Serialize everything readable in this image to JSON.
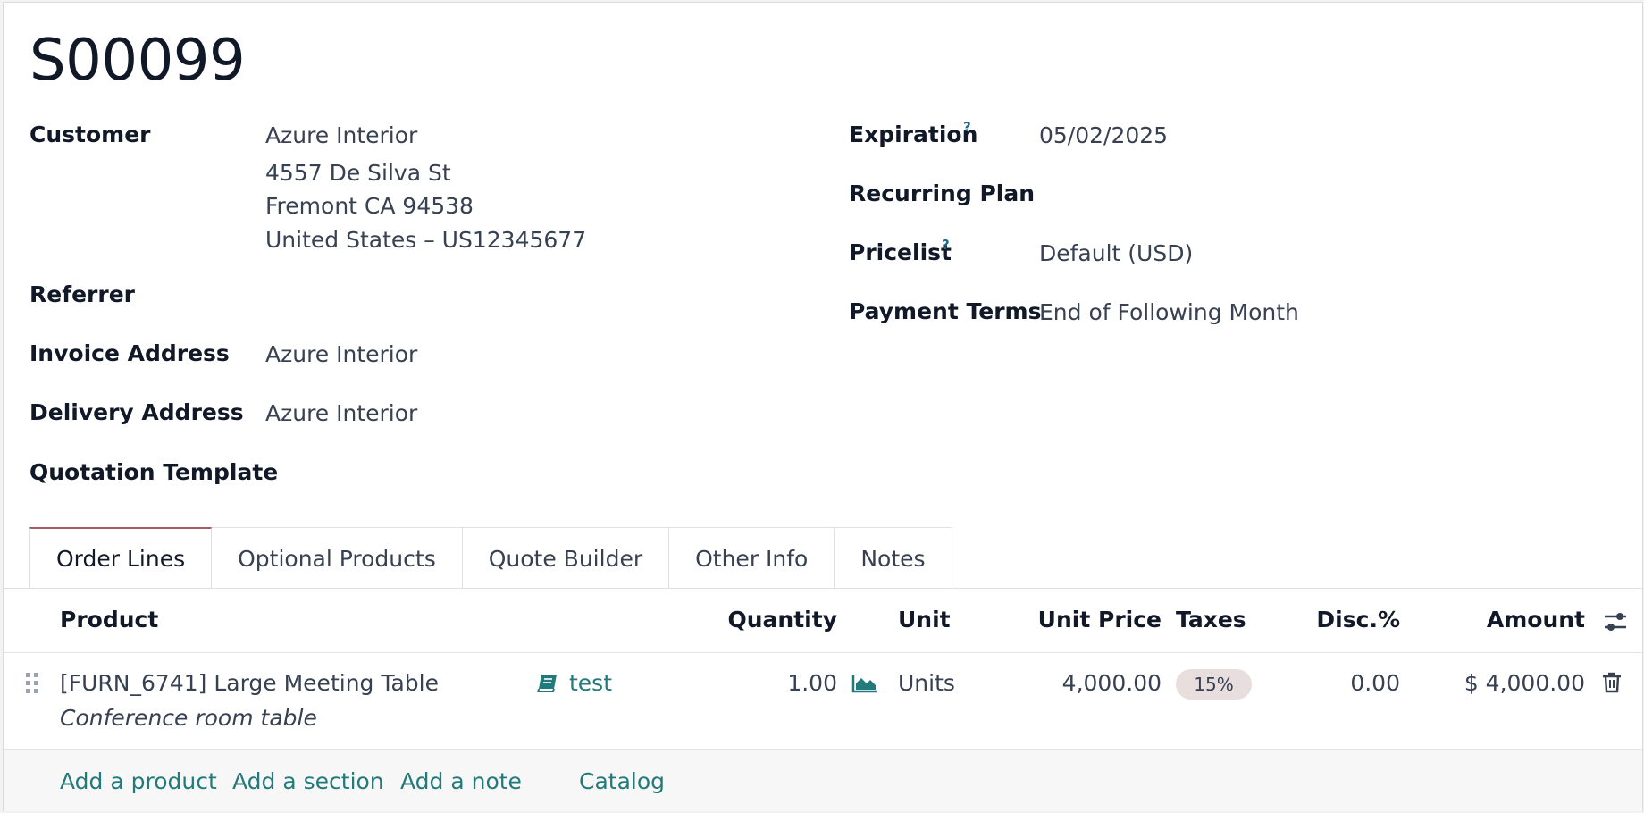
{
  "record": {
    "title": "S00099"
  },
  "left_fields": {
    "customer_label": "Customer",
    "customer_name": "Azure Interior",
    "customer_address_line1": "4557 De Silva St",
    "customer_address_line2": "Fremont CA 94538",
    "customer_address_line3": "United States – US12345677",
    "referrer_label": "Referrer",
    "invoice_address_label": "Invoice Address",
    "invoice_address_value": "Azure Interior",
    "delivery_address_label": "Delivery Address",
    "delivery_address_value": "Azure Interior",
    "quotation_template_label": "Quotation Template"
  },
  "right_fields": {
    "expiration_label": "Expiration",
    "expiration_help": "?",
    "expiration_value": "05/02/2025",
    "recurring_plan_label": "Recurring Plan",
    "pricelist_label": "Pricelist",
    "pricelist_help": "?",
    "pricelist_value": "Default (USD)",
    "payment_terms_label": "Payment Terms",
    "payment_terms_value": "End of Following Month"
  },
  "tabs": [
    {
      "label": "Order Lines",
      "active": true
    },
    {
      "label": "Optional Products"
    },
    {
      "label": "Quote Builder"
    },
    {
      "label": "Other Info"
    },
    {
      "label": "Notes"
    }
  ],
  "table": {
    "headers": {
      "product": "Product",
      "quantity": "Quantity",
      "unit": "Unit",
      "unit_price": "Unit Price",
      "taxes": "Taxes",
      "discount": "Disc.%",
      "amount": "Amount"
    },
    "rows": [
      {
        "product": "[FURN_6741] Large Meeting Table",
        "description": "Conference room table",
        "tag": "test",
        "quantity": "1.00",
        "unit": "Units",
        "unit_price": "4,000.00",
        "tax": "15%",
        "discount": "0.00",
        "amount": "$ 4,000.00"
      }
    ]
  },
  "footer_links": {
    "add_product": "Add a product",
    "add_section": "Add a section",
    "add_note": "Add a note",
    "catalog": "Catalog"
  },
  "icons": {
    "column_settings": "sliders-icon",
    "drag_handle": "drag-handle-icon",
    "book": "book-icon",
    "forecast": "area-chart-icon",
    "delete": "trash-icon"
  },
  "colors": {
    "link": "#237a7a",
    "active_tab": "#a85a66",
    "tax_badge": "#e8dede"
  }
}
